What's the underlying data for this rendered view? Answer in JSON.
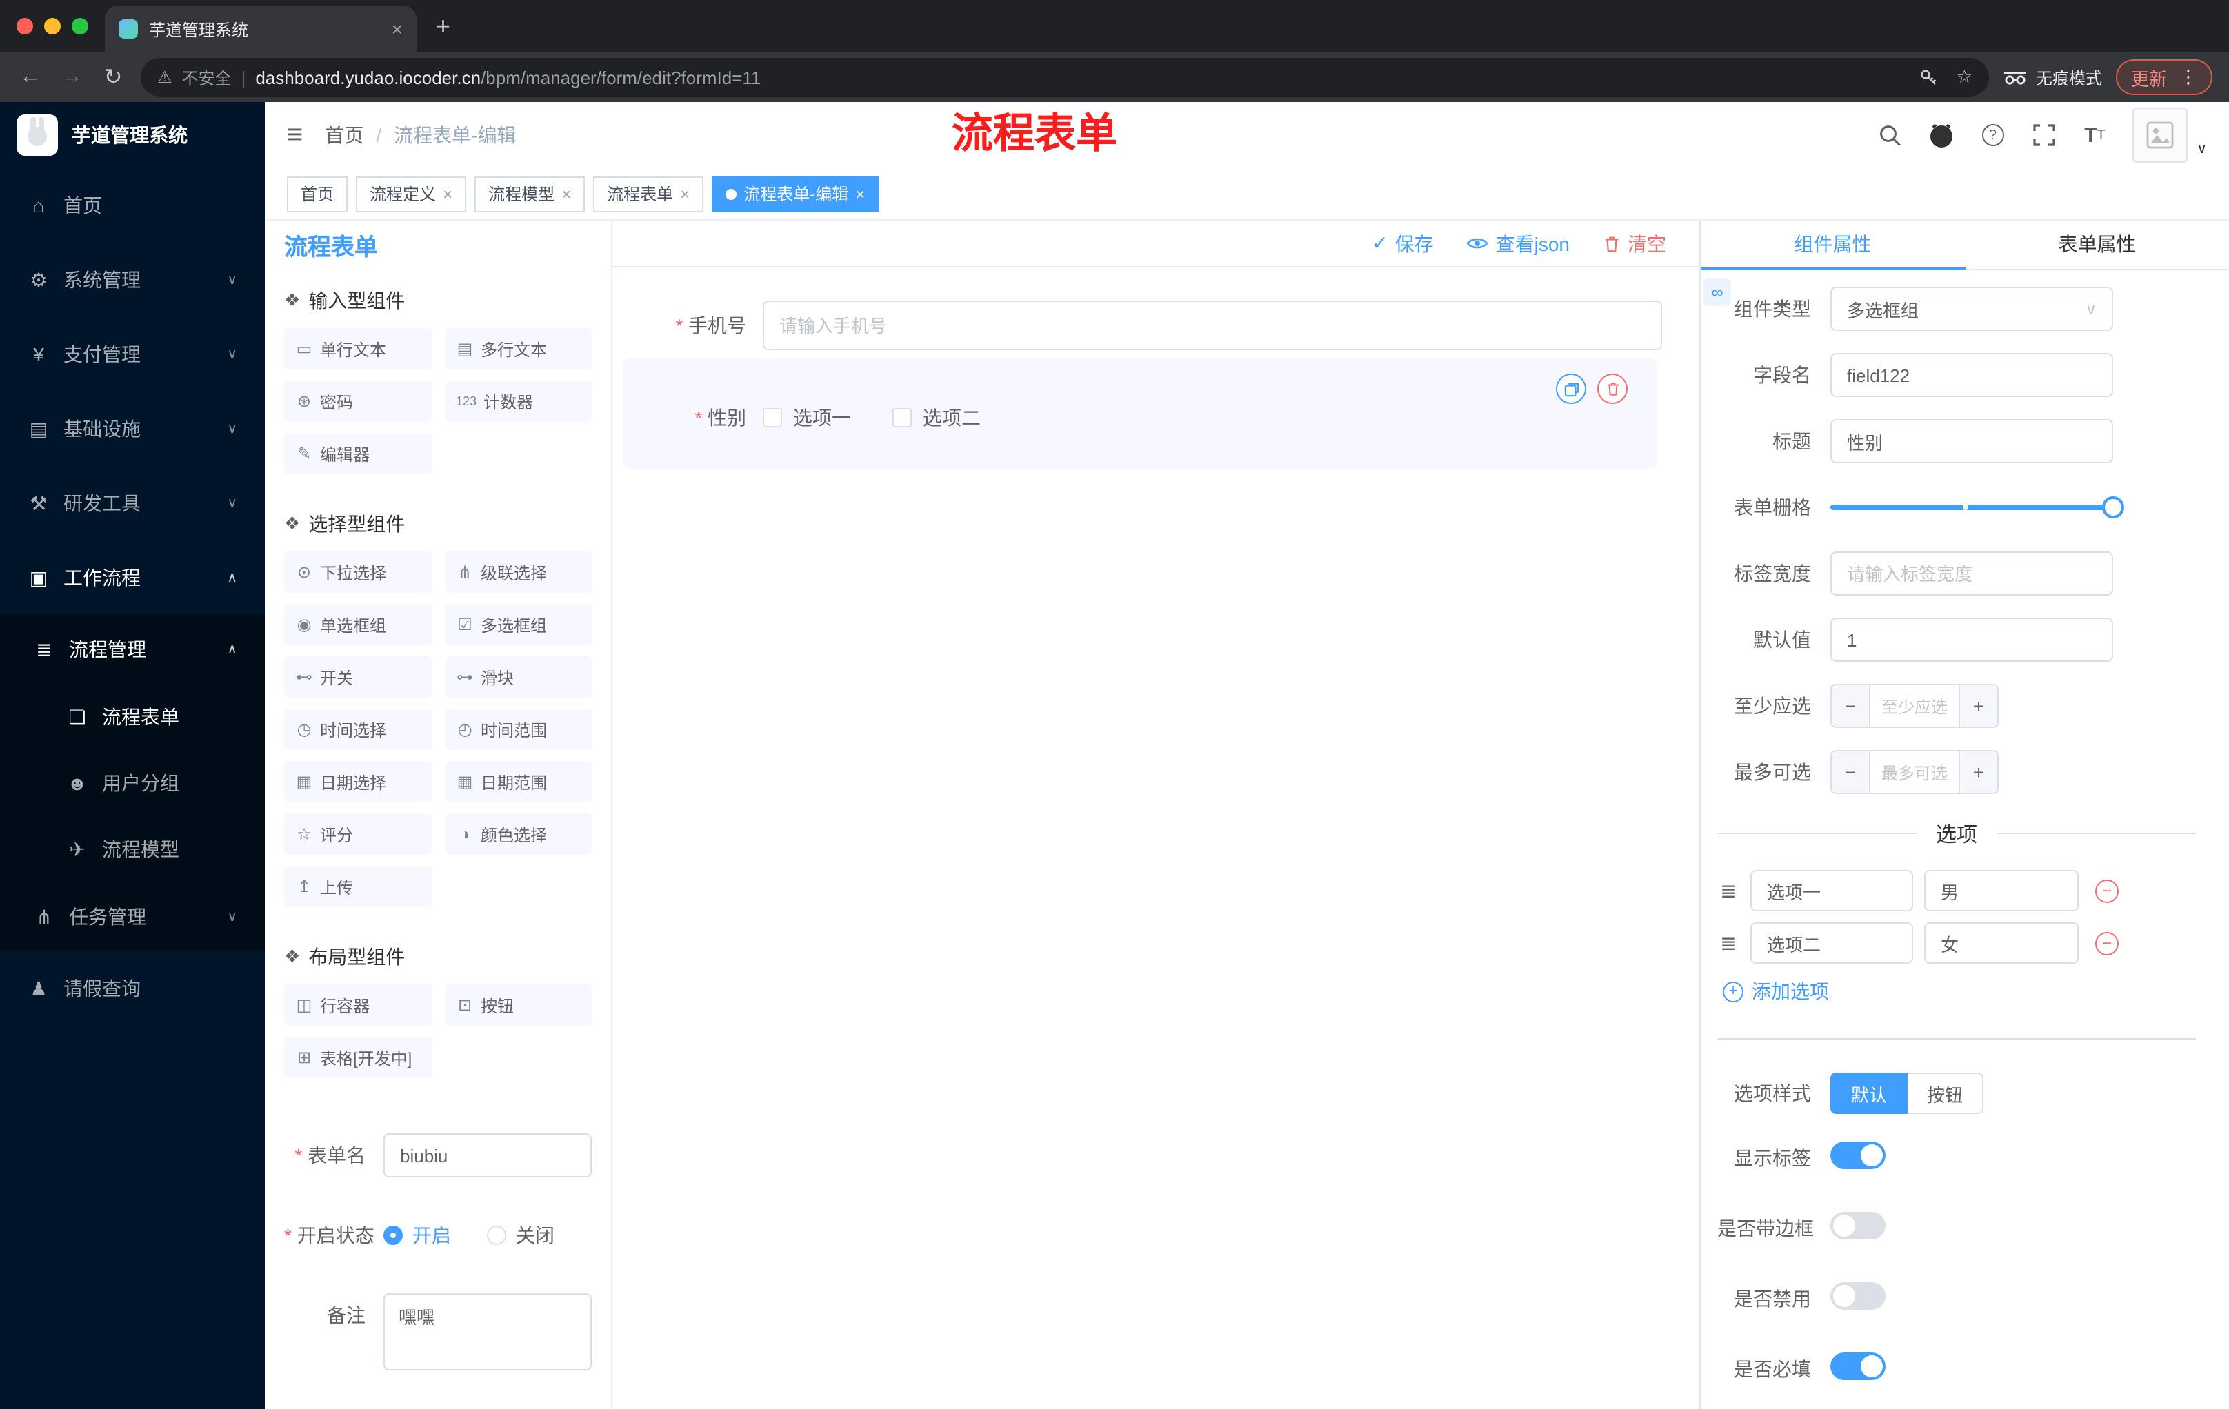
{
  "browser": {
    "tab_title": "芋道管理系统",
    "security": "不安全",
    "url_domain": "dashboard.yudao.iocoder.cn",
    "url_path": "/bpm/manager/form/edit?formId=11",
    "incognito": "无痕模式",
    "update": "更新"
  },
  "sidebar": {
    "logo": "芋道管理系统",
    "items": [
      {
        "icon": "⌂",
        "label": "首页",
        "chev": ""
      },
      {
        "icon": "⚙",
        "label": "系统管理",
        "chev": "∨"
      },
      {
        "icon": "¥",
        "label": "支付管理",
        "chev": "∨"
      },
      {
        "icon": "▤",
        "label": "基础设施",
        "chev": "∨"
      },
      {
        "icon": "⚒",
        "label": "研发工具",
        "chev": "∨"
      },
      {
        "icon": "▣",
        "label": "工作流程",
        "chev": "∧"
      }
    ],
    "sub": [
      {
        "icon": "≣",
        "label": "流程管理",
        "chev": "∧"
      },
      {
        "icon": "❏",
        "label": "流程表单"
      },
      {
        "icon": "☻",
        "label": "用户分组"
      },
      {
        "icon": "✈",
        "label": "流程模型"
      },
      {
        "icon": "⋔",
        "label": "任务管理",
        "chev": "∨"
      }
    ],
    "leave": {
      "icon": "♟",
      "label": "请假查询"
    }
  },
  "header": {
    "breadcrumb_home": "首页",
    "breadcrumb_current": "流程表单-编辑",
    "annotation": "流程表单"
  },
  "tags": [
    {
      "label": "首页"
    },
    {
      "label": "流程定义"
    },
    {
      "label": "流程模型"
    },
    {
      "label": "流程表单"
    },
    {
      "label": "流程表单-编辑"
    }
  ],
  "palette": {
    "title": "流程表单",
    "sec_input": "输入型组件",
    "input_items": [
      {
        "icon": "▭",
        "label": "单行文本"
      },
      {
        "icon": "▤",
        "label": "多行文本"
      },
      {
        "icon": "⊛",
        "label": "密码"
      },
      {
        "icon": "123",
        "label": "计数器"
      },
      {
        "icon": "✎",
        "label": "编辑器"
      }
    ],
    "sec_select": "选择型组件",
    "select_items": [
      {
        "icon": "⊙",
        "label": "下拉选择"
      },
      {
        "icon": "⋔",
        "label": "级联选择"
      },
      {
        "icon": "◉",
        "label": "单选框组"
      },
      {
        "icon": "☑",
        "label": "多选框组"
      },
      {
        "icon": "⊷",
        "label": "开关"
      },
      {
        "icon": "⊶",
        "label": "滑块"
      },
      {
        "icon": "◷",
        "label": "时间选择"
      },
      {
        "icon": "◴",
        "label": "时间范围"
      },
      {
        "icon": "▦",
        "label": "日期选择"
      },
      {
        "icon": "▦",
        "label": "日期范围"
      },
      {
        "icon": "☆",
        "label": "评分"
      },
      {
        "icon": "◑",
        "label": "颜色选择"
      },
      {
        "icon": "↥",
        "label": "上传"
      }
    ],
    "sec_layout": "布局型组件",
    "layout_items": [
      {
        "icon": "◫",
        "label": "行容器"
      },
      {
        "icon": "⊡",
        "label": "按钮"
      },
      {
        "icon": "⊞",
        "label": "表格[开发中]"
      }
    ],
    "form_name_label": "表单名",
    "form_name_value": "biubiu",
    "status_label": "开启状态",
    "status_on": "开启",
    "status_off": "关闭",
    "remark_label": "备注",
    "remark_value": "嘿嘿"
  },
  "toolbar": {
    "save": "保存",
    "view_json": "查看json",
    "clear": "清空"
  },
  "canvas": {
    "phone_label": "手机号",
    "phone_placeholder": "请输入手机号",
    "gender_label": "性别",
    "gender_opt1": "选项一",
    "gender_opt2": "选项二"
  },
  "props": {
    "tab_component": "组件属性",
    "tab_form": "表单属性",
    "type_label": "组件类型",
    "type_value": "多选框组",
    "field_label": "字段名",
    "field_value": "field122",
    "title_label": "标题",
    "title_value": "性别",
    "grid_label": "表单栅格",
    "labelw_label": "标签宽度",
    "labelw_placeholder": "请输入标签宽度",
    "default_label": "默认值",
    "default_value": "1",
    "min_label": "至少应选",
    "min_placeholder": "至少应选",
    "max_label": "最多可选",
    "max_placeholder": "最多可选",
    "options_divider": "选项",
    "options": [
      {
        "name": "选项一",
        "value": "男"
      },
      {
        "name": "选项二",
        "value": "女"
      }
    ],
    "add_option": "添加选项",
    "style_label": "选项样式",
    "style_default": "默认",
    "style_button": "按钮",
    "switch_show": "显示标签",
    "switch_border": "是否带边框",
    "switch_disabled": "是否禁用",
    "switch_required": "是否必填"
  },
  "colors": {
    "accent": "#409eff",
    "danger": "#f56c6c",
    "sidebar_bg": "#001529",
    "annotation": "#fe1c1c"
  }
}
